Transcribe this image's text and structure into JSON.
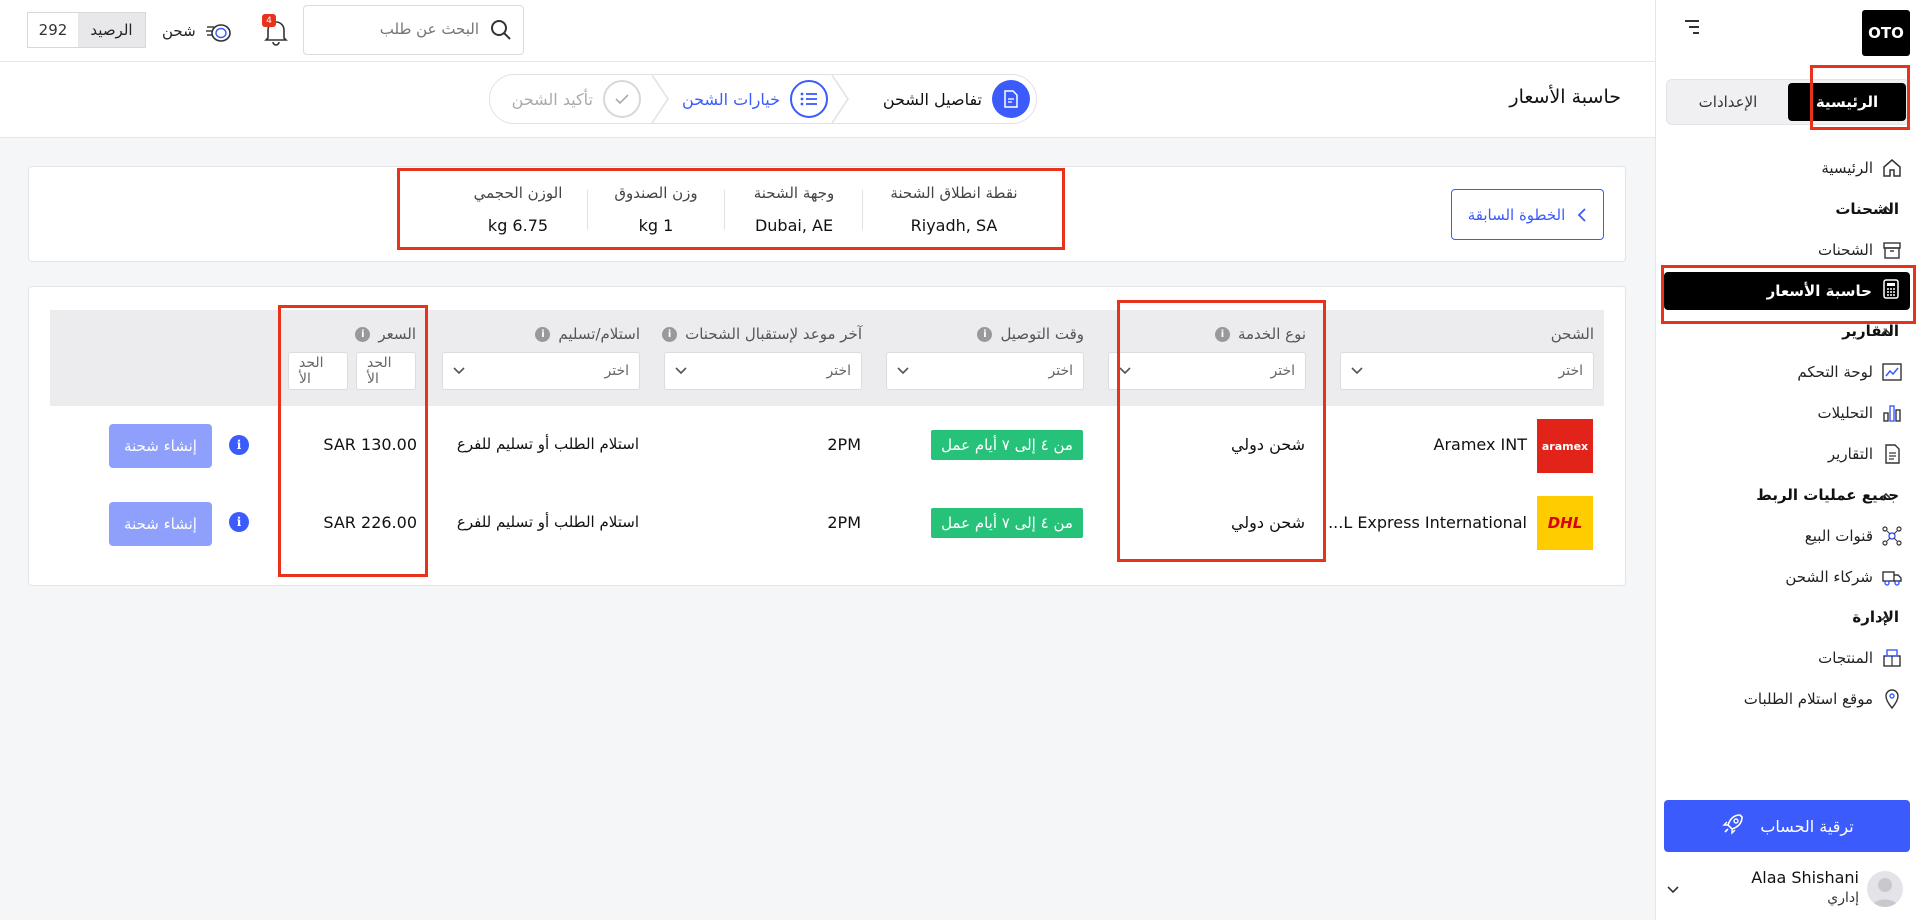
{
  "sidebar": {
    "logo": "OTO",
    "tabs": {
      "main": "الرئيسية",
      "settings": "الإعدادات"
    },
    "items": {
      "home": "الرئيسية",
      "shipments_section": "الشحنات",
      "shipments": "الشحنات",
      "price_calculator": "حاسبة الأسعار",
      "reports_section": "التقارير",
      "dashboard": "لوحة التحكم",
      "analytics": "التحليلات",
      "reports": "التقارير",
      "integrations_section": "جميع عمليات الربط",
      "sales_channels": "قنوات البيع",
      "shipping_partners": "شركاء الشحن",
      "admin_section": "الإدارة",
      "products": "المنتجات",
      "pickup_locations": "موقع استلام الطلبات"
    },
    "upgrade": "ترقية الحساب",
    "user": {
      "name": "Alaa Shishani",
      "role": "إداري"
    }
  },
  "topbar": {
    "search_placeholder": "البحث عن طلب",
    "notifications_count": "4",
    "ship_label": "شحن",
    "balance_label": "الرصيد",
    "balance_value": "292"
  },
  "page": {
    "title": "حاسبة الأسعار",
    "steps": [
      {
        "label": "تفاصيل الشحن"
      },
      {
        "label": "خيارات الشحن"
      },
      {
        "label": "تأكيد الشحن"
      }
    ]
  },
  "summary": {
    "prev_button": "الخطوة السابقة",
    "origin": {
      "label": "نقطة انطلاق الشحنة",
      "value": "Riyadh, SA"
    },
    "destination": {
      "label": "وجهة الشحنة",
      "value": "Dubai, AE"
    },
    "box_weight": {
      "label": "وزن الصندوق",
      "value": "kg 1"
    },
    "volumetric_weight": {
      "label": "الوزن الحجمي",
      "value": "kg 6.75"
    }
  },
  "table": {
    "headers": {
      "carrier": "الشحن",
      "service_type": "نوع الخدمة",
      "delivery_time": "وقت التوصيل",
      "cutoff": "آخر موعد لإستقبال الشحنات",
      "pickup_delivery": "استلام/تسليم",
      "price": "السعر"
    },
    "filter_placeholder": "اختر",
    "price_min": "الحد الأ",
    "price_max": "الحد الأ",
    "rows": [
      {
        "carrier": "Aramex INT",
        "logo_text": "aramex",
        "service_type": "شحن دولي",
        "delivery_time": "من ٤ إلى ٧ أيام عمل",
        "cutoff": "2PM",
        "pickup_delivery": "استلام الطلب أو تسليم للفرع",
        "price": "SAR 130.00",
        "action": "إنشاء شحنة"
      },
      {
        "carrier": "...L Express International",
        "logo_text": "DHL",
        "service_type": "شحن دولي",
        "delivery_time": "من ٤ إلى ٧ أيام عمل",
        "cutoff": "2PM",
        "pickup_delivery": "استلام الطلب أو تسليم للفرع",
        "price": "SAR 226.00",
        "action": "إنشاء شحنة"
      }
    ]
  },
  "colors": {
    "accent": "#3b5bfd",
    "badge": "#27c27a",
    "highlight": "#e8321c",
    "aramex": "#e2231a",
    "dhl": "#ffcc00"
  }
}
